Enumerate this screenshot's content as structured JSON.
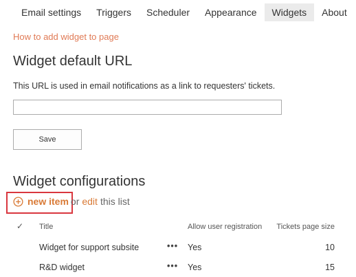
{
  "tabs": [
    {
      "label": "Email settings",
      "active": false
    },
    {
      "label": "Triggers",
      "active": false
    },
    {
      "label": "Scheduler",
      "active": false
    },
    {
      "label": "Appearance",
      "active": false
    },
    {
      "label": "Widgets",
      "active": true
    },
    {
      "label": "About",
      "active": false
    }
  ],
  "help_link": "How to add widget to page",
  "default_url": {
    "title": "Widget default URL",
    "description": "This URL is used in email notifications as a link to requesters' tickets.",
    "input_value": "",
    "save_label": "Save"
  },
  "configs": {
    "title": "Widget configurations",
    "new_item_label": "new item",
    "or_text": "or",
    "edit_label": "edit",
    "suffix_text": "this list",
    "columns": {
      "title": "Title",
      "allow_registration": "Allow user registration",
      "page_size": "Tickets page size"
    },
    "rows": [
      {
        "title": "Widget for support subsite",
        "menu": "•••",
        "allow_registration": "Yes",
        "page_size": "10"
      },
      {
        "title": "R&D widget",
        "menu": "•••",
        "allow_registration": "Yes",
        "page_size": "15"
      }
    ]
  },
  "colors": {
    "accent": "#d97a36",
    "help_link": "#e07a55",
    "highlight_border": "#d9363e",
    "active_tab_bg": "#ebebeb"
  },
  "icons": {
    "add": "plus-circle-icon",
    "select_all": "checkmark-icon"
  }
}
